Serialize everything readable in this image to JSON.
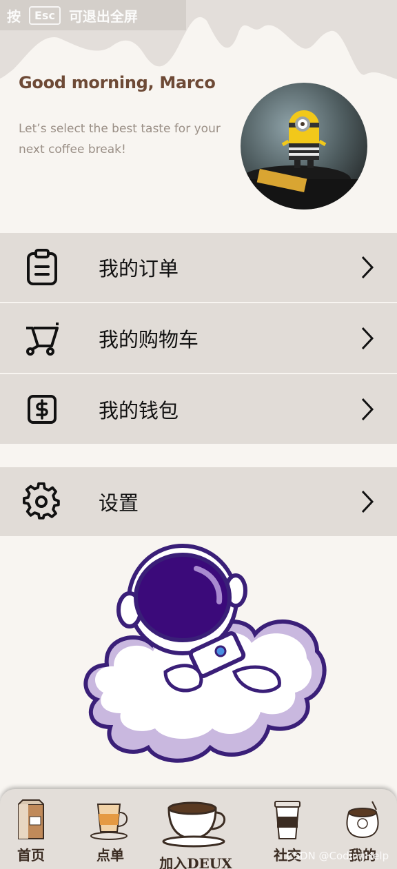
{
  "overlay": {
    "text": "按",
    "key": "Esc",
    "suffix": "可退出全屏"
  },
  "header": {
    "greeting": "Good morning, Marco",
    "subtitle": "Let’s select the best taste for your next coffee break!"
  },
  "menu": [
    {
      "label": "我的订单",
      "icon": "clipboard-icon"
    },
    {
      "label": "我的购物车",
      "icon": "cart-icon"
    },
    {
      "label": "我的钱包",
      "icon": "wallet-dollar-icon"
    }
  ],
  "settings": {
    "label": "设置",
    "icon": "gear-icon"
  },
  "tabs": [
    {
      "label": "首页",
      "icon": "coffee-bag-icon"
    },
    {
      "label": "点单",
      "icon": "latte-glass-icon"
    },
    {
      "label": "加入DEUX",
      "icon": "coffee-cup-icon"
    },
    {
      "label": "社交",
      "icon": "takeaway-cup-icon"
    },
    {
      "label": "我的",
      "icon": "coffee-sack-icon"
    }
  ],
  "watermark": "CSDN @CodingHelp",
  "colors": {
    "accent": "#6e4a36",
    "menu_bg": "#e1dcd7",
    "page_bg": "#f8f5f1"
  }
}
